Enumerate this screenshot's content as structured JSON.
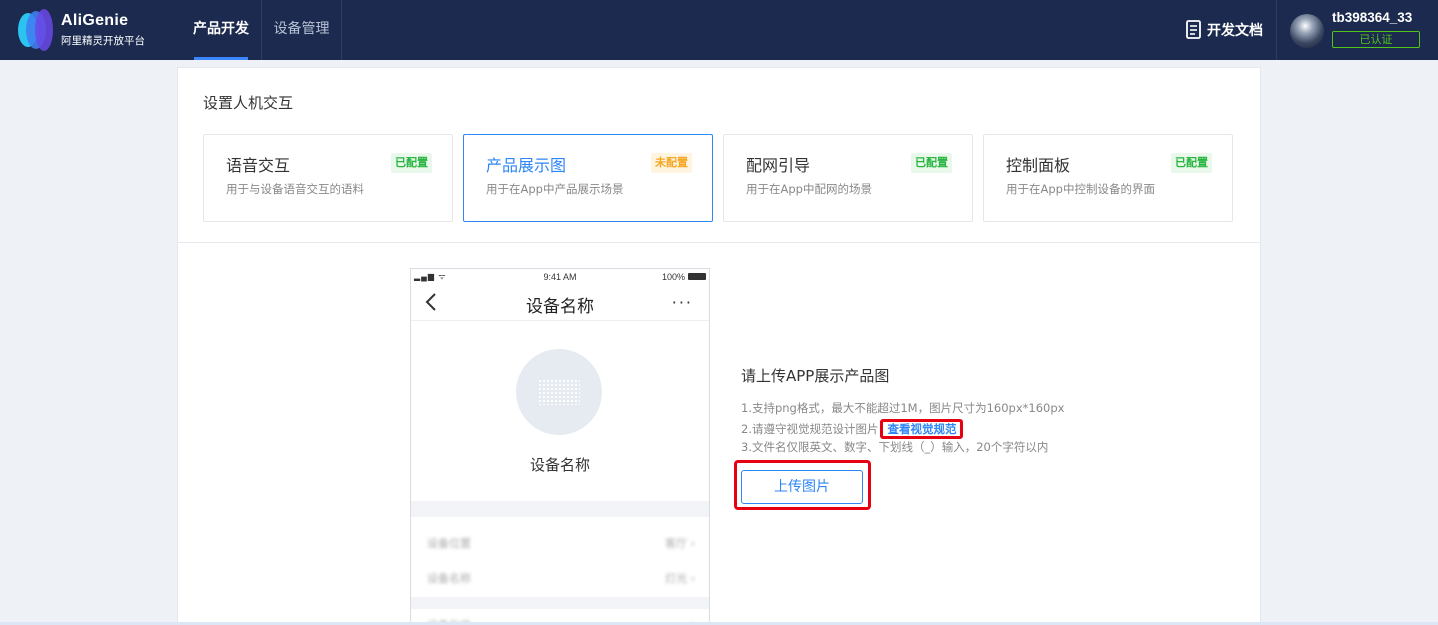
{
  "header": {
    "brand_name": "AliGenie",
    "brand_sub": "阿里精灵开放平台",
    "tabs": [
      {
        "label": "产品开发",
        "active": true
      },
      {
        "label": "设备管理",
        "active": false
      }
    ],
    "docs_label": "开发文档",
    "username": "tb398364_33",
    "verified_label": "已认证"
  },
  "section": {
    "title": "设置人机交互",
    "cards": [
      {
        "title": "语音交互",
        "desc": "用于与设备语音交互的语料",
        "status": "已配置",
        "configured": true
      },
      {
        "title": "产品展示图",
        "desc": "用于在App中产品展示场景",
        "status": "未配置",
        "configured": false
      },
      {
        "title": "配网引导",
        "desc": "用于在App中配网的场景",
        "status": "已配置",
        "configured": true
      },
      {
        "title": "控制面板",
        "desc": "用于在App中控制设备的界面",
        "status": "已配置",
        "configured": true
      }
    ]
  },
  "phone": {
    "time": "9:41 AM",
    "battery": "100%",
    "nav_title": "设备名称",
    "device_name": "设备名称",
    "rows": [
      {
        "label": "设备位置",
        "value": "客厅"
      },
      {
        "label": "设备名称",
        "value": "灯光"
      },
      {
        "label": "设备升级",
        "value": ""
      }
    ]
  },
  "upload": {
    "title": "请上传APP展示产品图",
    "rule1": "1.支持png格式，最大不能超过1M，图片尺寸为160px*160px",
    "rule2": "2.请遵守视觉规范设计图片",
    "spec_link": "查看视觉规范",
    "rule3": "3.文件名仅限英文、数字、下划线（_）输入，20个字符以内",
    "button_label": "上传图片"
  },
  "colors": {
    "nav_bg": "#1b2a4e",
    "accent": "#2f86f6",
    "configured": "#27b53f",
    "unconfigured": "#f5a623",
    "highlight": "#e60012"
  }
}
